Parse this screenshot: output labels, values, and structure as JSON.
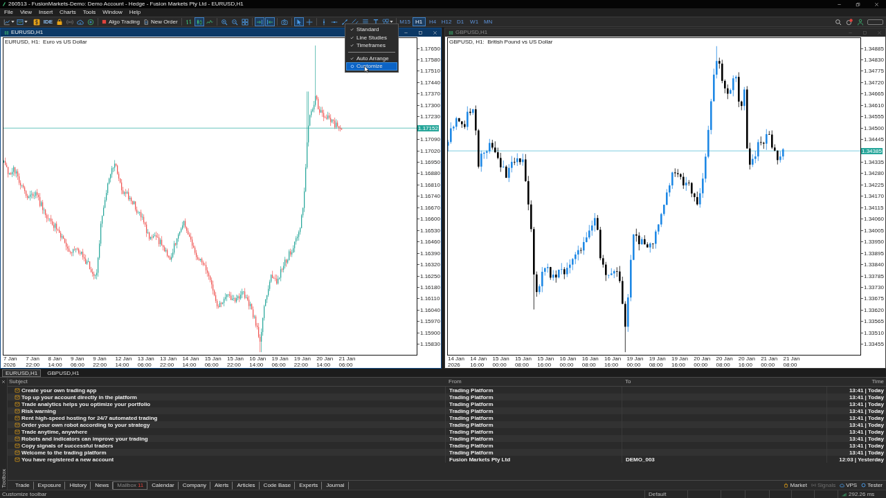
{
  "window": {
    "title": "260513 - FusionMarkets-Demo: Demo Account - Hedge - Fusion Markets Pty Ltd - EURUSD,H1"
  },
  "menu": [
    "File",
    "View",
    "Insert",
    "Charts",
    "Tools",
    "Window",
    "Help"
  ],
  "toolbar": {
    "ide": "IDE",
    "algo_trading": "Algo Trading",
    "new_order": "New Order",
    "chart_modes": [
      {
        "selected": false
      },
      {
        "selected": true
      },
      {
        "selected": false
      }
    ],
    "scroll_modes": [
      {
        "selected": true
      },
      {
        "selected": true
      }
    ],
    "cursor_modes": [
      {
        "selected": true
      },
      {
        "selected": false
      }
    ],
    "timeframes": [
      {
        "label": "M15",
        "selected": false
      },
      {
        "label": "H1",
        "selected": true
      },
      {
        "label": "H4",
        "selected": false
      },
      {
        "label": "H12",
        "selected": false
      },
      {
        "label": "D1",
        "selected": false
      },
      {
        "label": "W1",
        "selected": false
      },
      {
        "label": "MN",
        "selected": false
      }
    ]
  },
  "toolbar_menu": {
    "groups": [
      [
        {
          "kind": "toggle",
          "label": "Standard",
          "checked": true,
          "selected": false
        },
        {
          "kind": "toggle",
          "label": "Line Studies",
          "checked": true,
          "selected": false
        },
        {
          "kind": "toggle",
          "label": "Timeframes",
          "checked": true,
          "selected": false
        }
      ],
      [
        {
          "kind": "toggle",
          "label": "Auto Arrange",
          "checked": true,
          "selected": false
        },
        {
          "kind": "command",
          "label": "Customize",
          "selected": true
        }
      ]
    ]
  },
  "charts": [
    {
      "title": "EURUSD,H1",
      "active": true,
      "caption": "EURUSD, H1:  Euro vs US Dollar",
      "price_axis": [
        {
          "kind": "tick",
          "text": "1.17650"
        },
        {
          "kind": "tick",
          "text": "1.17580"
        },
        {
          "kind": "tick",
          "text": "1.17510"
        },
        {
          "kind": "tick",
          "text": "1.17440"
        },
        {
          "kind": "tick",
          "text": "1.17370"
        },
        {
          "kind": "tick",
          "text": "1.17300"
        },
        {
          "kind": "tick",
          "text": "1.17230"
        },
        {
          "kind": "current",
          "text": "1.17152"
        },
        {
          "kind": "tick",
          "text": "1.17090"
        },
        {
          "kind": "tick",
          "text": "1.17020"
        },
        {
          "kind": "tick",
          "text": "1.16950"
        },
        {
          "kind": "tick",
          "text": "1.16880"
        },
        {
          "kind": "tick",
          "text": "1.16810"
        },
        {
          "kind": "tick",
          "text": "1.16740"
        },
        {
          "kind": "tick",
          "text": "1.16670"
        },
        {
          "kind": "tick",
          "text": "1.16600"
        },
        {
          "kind": "tick",
          "text": "1.16530"
        },
        {
          "kind": "tick",
          "text": "1.16460"
        },
        {
          "kind": "tick",
          "text": "1.16390"
        },
        {
          "kind": "tick",
          "text": "1.16320"
        },
        {
          "kind": "tick",
          "text": "1.16250"
        },
        {
          "kind": "tick",
          "text": "1.16180"
        },
        {
          "kind": "tick",
          "text": "1.16110"
        },
        {
          "kind": "tick",
          "text": "1.16040"
        },
        {
          "kind": "tick",
          "text": "1.15970"
        },
        {
          "kind": "tick",
          "text": "1.15900"
        },
        {
          "kind": "tick",
          "text": "1.15830"
        }
      ],
      "time_axis": [
        "7 Jan 2026",
        "7 Jan 22:00",
        "8 Jan 14:00",
        "9 Jan 06:00",
        "9 Jan 22:00",
        "12 Jan 14:00",
        "13 Jan 06:00",
        "13 Jan 22:00",
        "14 Jan 14:00",
        "15 Jan 06:00",
        "15 Jan 22:00",
        "16 Jan 14:00",
        "19 Jan 06:00",
        "19 Jan 22:00",
        "20 Jan 14:00",
        "21 Jan 06:00"
      ]
    },
    {
      "title": "GBPUSD,H1",
      "active": false,
      "caption": "GBPUSD, H1:  British Pound vs US Dollar",
      "price_axis": [
        {
          "kind": "tick",
          "text": "1.34885"
        },
        {
          "kind": "tick",
          "text": "1.34830"
        },
        {
          "kind": "tick",
          "text": "1.34775"
        },
        {
          "kind": "tick",
          "text": "1.34720"
        },
        {
          "kind": "tick",
          "text": "1.34665"
        },
        {
          "kind": "tick",
          "text": "1.34610"
        },
        {
          "kind": "tick",
          "text": "1.34555"
        },
        {
          "kind": "tick",
          "text": "1.34500"
        },
        {
          "kind": "tick",
          "text": "1.34445"
        },
        {
          "kind": "current",
          "text": "1.34385"
        },
        {
          "kind": "tick",
          "text": "1.34335"
        },
        {
          "kind": "tick",
          "text": "1.34280"
        },
        {
          "kind": "tick",
          "text": "1.34225"
        },
        {
          "kind": "tick",
          "text": "1.34170"
        },
        {
          "kind": "tick",
          "text": "1.34115"
        },
        {
          "kind": "tick",
          "text": "1.34060"
        },
        {
          "kind": "tick",
          "text": "1.34005"
        },
        {
          "kind": "tick",
          "text": "1.33950"
        },
        {
          "kind": "tick",
          "text": "1.33895"
        },
        {
          "kind": "tick",
          "text": "1.33840"
        },
        {
          "kind": "tick",
          "text": "1.33785"
        },
        {
          "kind": "tick",
          "text": "1.33730"
        },
        {
          "kind": "tick",
          "text": "1.33675"
        },
        {
          "kind": "tick",
          "text": "1.33620"
        },
        {
          "kind": "tick",
          "text": "1.33565"
        },
        {
          "kind": "tick",
          "text": "1.33510"
        },
        {
          "kind": "tick",
          "text": "1.33455"
        }
      ],
      "time_axis": [
        "14 Jan 2026",
        "14 Jan 16:00",
        "15 Jan 00:00",
        "15 Jan 08:00",
        "15 Jan 16:00",
        "16 Jan 00:00",
        "16 Jan 08:00",
        "16 Jan 16:00",
        "19 Jan 00:00",
        "19 Jan 08:00",
        "19 Jan 16:00",
        "20 Jan 00:00",
        "20 Jan 08:00",
        "20 Jan 16:00",
        "21 Jan 00:00",
        "21 Jan 08:00"
      ]
    }
  ],
  "chart_tabs": [
    {
      "label": "EURUSD,H1",
      "selected": true
    },
    {
      "label": "GBPUSD,H1",
      "selected": false
    }
  ],
  "toolbox": {
    "title": "Toolbox",
    "columns": [
      "Subject",
      "From",
      "To",
      "Time"
    ],
    "messages": [
      {
        "subject": "Create your own trading app",
        "from": "Trading Platform",
        "time": "13:41 | Today",
        "unread": true
      },
      {
        "subject": "Top up your account directly in the platform",
        "from": "Trading Platform",
        "time": "13:41 | Today",
        "unread": true
      },
      {
        "subject": "Trade analytics helps you optimize your portfolio",
        "from": "Trading Platform",
        "time": "13:41 | Today",
        "unread": true
      },
      {
        "subject": "Risk warning",
        "from": "Trading Platform",
        "time": "13:41 | Today",
        "unread": true
      },
      {
        "subject": "Rent high-speed hosting for 24/7 automated trading",
        "from": "Trading Platform",
        "time": "13:41 | Today",
        "unread": true
      },
      {
        "subject": "Order your own robot according to your strategy",
        "from": "Trading Platform",
        "time": "13:41 | Today",
        "unread": true
      },
      {
        "subject": "Trade anytime, anywhere",
        "from": "Trading Platform",
        "time": "13:41 | Today",
        "unread": true
      },
      {
        "subject": "Robots and indicators can improve your trading",
        "from": "Trading Platform",
        "time": "13:41 | Today",
        "unread": true
      },
      {
        "subject": "Copy signals of successful traders",
        "from": "Trading Platform",
        "time": "13:41 | Today",
        "unread": true
      },
      {
        "subject": "Welcome to the trading platform",
        "from": "Trading Platform",
        "time": "13:41 | Today",
        "unread": true
      },
      {
        "subject": "You have registered a new account",
        "from": "Fusion Markets Pty Ltd",
        "to": "DEMO_003",
        "time": "12:03 | Yesterday",
        "unread": true
      }
    ],
    "tabs": [
      {
        "label": "Trade",
        "selected": false
      },
      {
        "label": "Exposure",
        "selected": false
      },
      {
        "label": "History",
        "selected": false
      },
      {
        "label": "News",
        "selected": false
      },
      {
        "label": "Mailbox",
        "selected": true,
        "badge": "11"
      },
      {
        "label": "Calendar",
        "selected": false
      },
      {
        "label": "Company",
        "selected": false
      },
      {
        "label": "Alerts",
        "selected": false
      },
      {
        "label": "Articles",
        "selected": false
      },
      {
        "label": "Code Base",
        "selected": false
      },
      {
        "label": "Experts",
        "selected": false
      },
      {
        "label": "Journal",
        "selected": false
      }
    ],
    "services": [
      {
        "label": "Market",
        "disabled": false
      },
      {
        "label": "Signals",
        "disabled": true
      },
      {
        "label": "VPS",
        "disabled": false
      },
      {
        "label": "Tester",
        "disabled": false
      }
    ]
  },
  "status_bar": {
    "hint": "Customize toolbar",
    "profile": "Default",
    "ping": "292.26 ms"
  }
}
